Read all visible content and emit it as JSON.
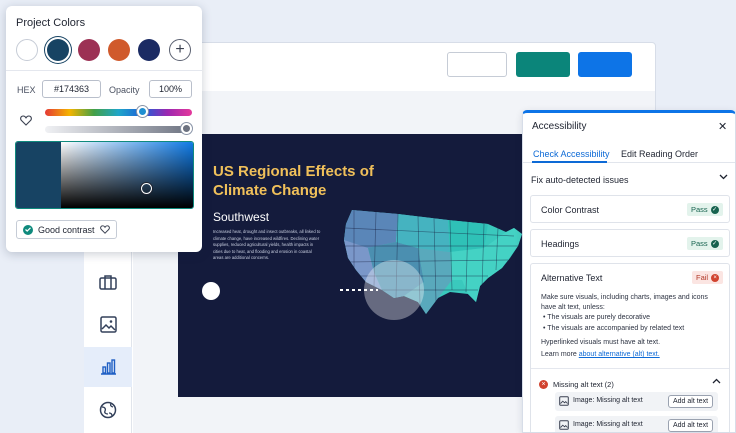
{
  "color_picker": {
    "title": "Project Colors",
    "swatches": [
      {
        "name": "white",
        "color": "#ffffff"
      },
      {
        "name": "navy-selected",
        "color": "#174363"
      },
      {
        "name": "berry",
        "color": "#9c3154"
      },
      {
        "name": "orange",
        "color": "#d05a2c"
      },
      {
        "name": "dark-blue",
        "color": "#1b2b63"
      }
    ],
    "hex_label": "HEX",
    "hex_value": "#174363",
    "opacity_label": "Opacity",
    "opacity_value": "100%",
    "contrast_label": "Good contrast"
  },
  "slide": {
    "title": "US Regional Effects of Climate Change",
    "subtitle": "Southwest",
    "body": "Increased heat, drought and insect outbreaks, all linked to climate change, have increased wildfires. Declining water supplies, reduced agricultural yields, health impacts in cities due to heat, and flooding and erosion in coastal areas are additional concerns."
  },
  "accessibility": {
    "title": "Accessibility",
    "tabs": [
      "Check Accessibility",
      "Edit Reading Order"
    ],
    "fix_section": "Fix auto-detected issues",
    "checks": [
      {
        "label": "Color Contrast",
        "status": "Pass"
      },
      {
        "label": "Headings",
        "status": "Pass"
      },
      {
        "label": "Alternative Text",
        "status": "Fail"
      }
    ],
    "alt_text_desc": "Make sure visuals, including charts, images and icons have alt text, unless:",
    "bullets": [
      "The visuals are purely decorative",
      "The visuals are accompanied by related text"
    ],
    "hyperlink_note": "Hyperlinked visuals must have alt text.",
    "learn_more_prefix": "Learn more",
    "learn_more_link": "about alternative (alt) text.",
    "missing_header": "Missing alt text (2)",
    "missing_items": [
      {
        "label": "Image: Missing alt text",
        "action": "Add alt text"
      },
      {
        "label": "Image: Missing alt text",
        "action": "Add alt text"
      }
    ]
  },
  "colors": {
    "accent": "#0d74e7",
    "teal": "#0b857a",
    "slide_bg": "#141b3c",
    "slide_title": "#f0c05a",
    "pass": "#17634f",
    "fail": "#b23a2a"
  }
}
